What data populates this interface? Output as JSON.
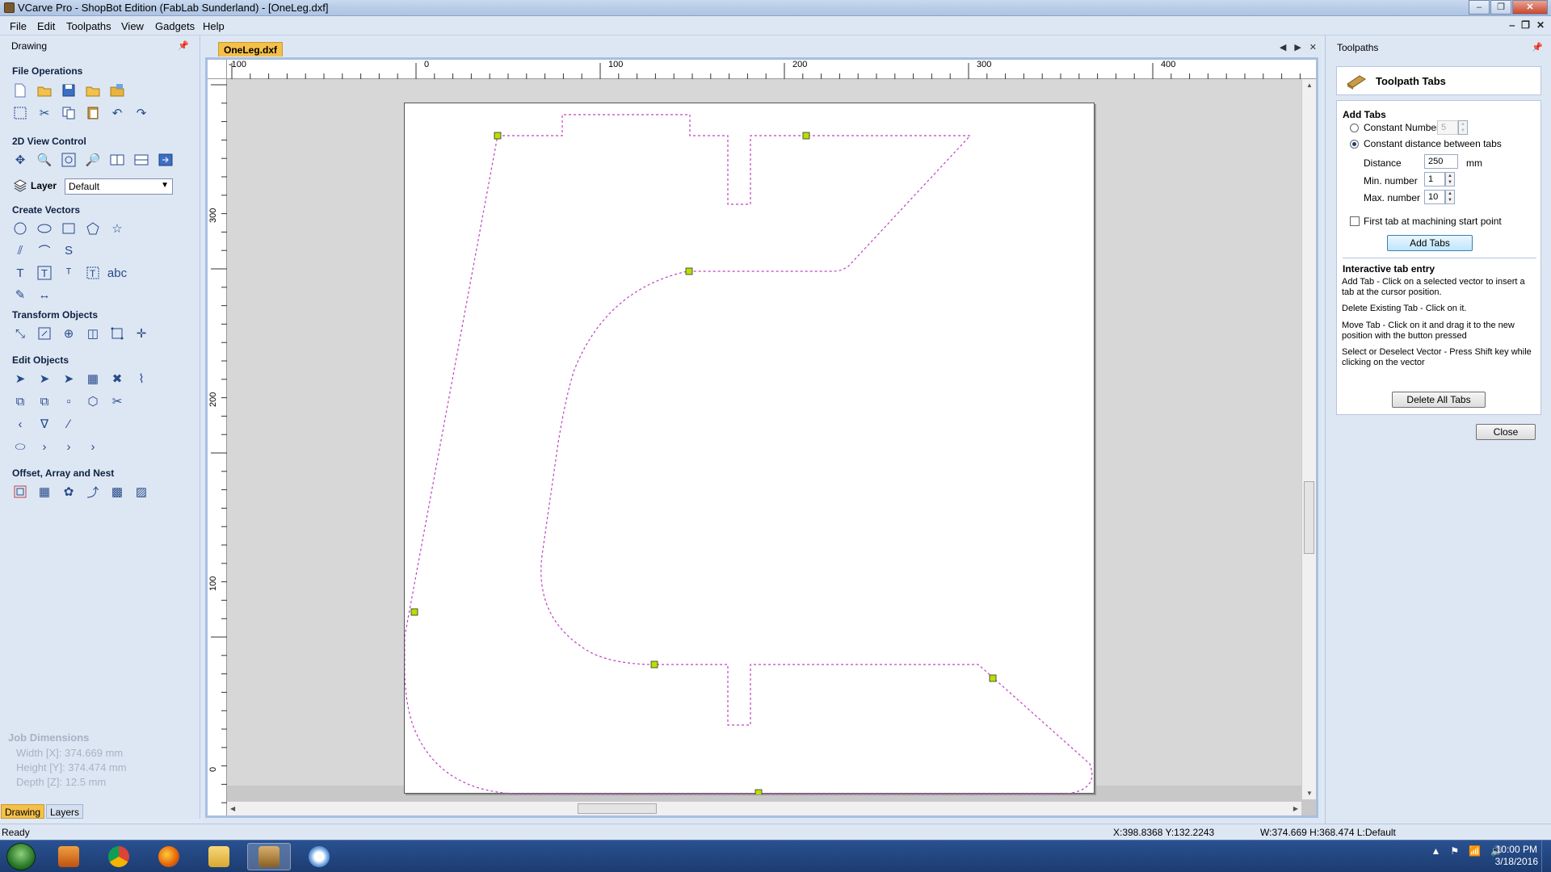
{
  "window": {
    "title": "VCarve Pro - ShopBot Edition (FabLab Sunderland) - [OneLeg.dxf]",
    "controls": [
      "–",
      "❐",
      "✕"
    ]
  },
  "menu": [
    "File",
    "Edit",
    "Toolpaths",
    "View",
    "Gadgets",
    "Help"
  ],
  "left_panel": {
    "header": "Drawing",
    "sections": {
      "file_operations": "File Operations",
      "view_control": "2D View Control",
      "layer_label": "Layer",
      "layer_value": "Default",
      "create_vectors": "Create Vectors",
      "transform_objects": "Transform Objects",
      "edit_objects": "Edit Objects",
      "offset_array_nest": "Offset, Array and Nest"
    },
    "job_dimensions": {
      "title": "Job Dimensions",
      "width": "Width  [X]: 374.669 mm",
      "height": "Height [Y]: 374.474 mm",
      "depth": "Depth  [Z]: 12.5 mm"
    },
    "tabs": [
      "Drawing",
      "Layers"
    ]
  },
  "document": {
    "tab": "OneLeg.dxf",
    "ruler_top": [
      "-100",
      "0",
      "100",
      "200",
      "300",
      "400"
    ],
    "ruler_left": [
      "300",
      "200",
      "100",
      "0"
    ]
  },
  "right_panel": {
    "header": "Toolpaths",
    "title": "Toolpath Tabs",
    "add_tabs": {
      "section": "Add Tabs",
      "constant_number_label": "Constant Number",
      "constant_number_value": "5",
      "constant_distance_label": "Constant distance between tabs",
      "distance_label": "Distance",
      "distance_value": "250",
      "distance_unit": "mm",
      "min_label": "Min. number",
      "min_value": "1",
      "max_label": "Max. number",
      "max_value": "10",
      "first_tab_label": "First tab at machining start point",
      "add_button": "Add Tabs"
    },
    "interactive": {
      "section": "Interactive tab entry",
      "add_tab": "Add Tab - Click on a selected vector to insert a tab at the cursor position.",
      "delete_tab": "Delete Existing Tab - Click on it.",
      "move_tab": "Move Tab - Click on it and drag it to the new position with the button pressed",
      "select_vector": "Select or Deselect Vector - Press Shift key while clicking on the vector",
      "delete_all_button": "Delete All Tabs"
    },
    "close_button": "Close"
  },
  "status": {
    "left": "Ready",
    "coords": "X:398.8368 Y:132.2243",
    "dims": "W:374.669   H:368.474   L:Default"
  },
  "taskbar": {
    "time": "10:00 PM",
    "date": "3/18/2016"
  },
  "colors": {
    "vector": "#c040c0",
    "tab_marker": "#b8e000",
    "accent_tab": "#f4c04a"
  }
}
